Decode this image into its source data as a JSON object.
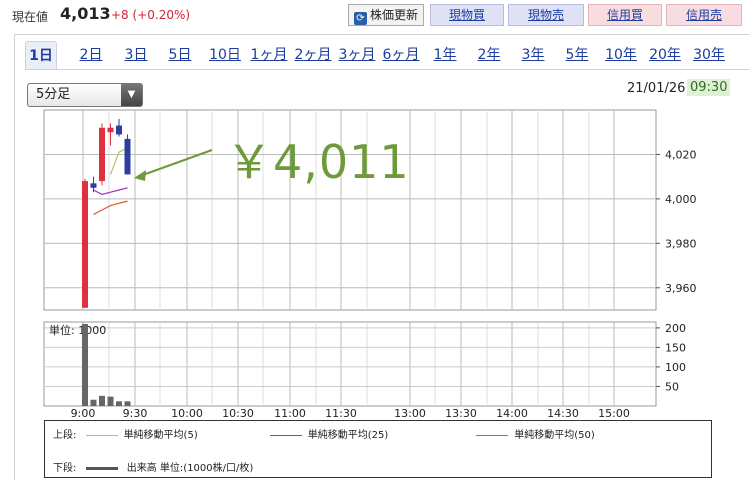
{
  "header": {
    "price_label": "現在値",
    "price_value": "4,013",
    "price_change": "+8 (+0.20%)",
    "refresh_label": "株価更新",
    "genbuy_label": "現物買",
    "gensell_label": "現物売",
    "crbuy_label": "信用買",
    "crsell_label": "信用売"
  },
  "tabs": [
    "1日",
    "2日",
    "3日",
    "5日",
    "10日",
    "1ヶ月",
    "2ヶ月",
    "3ヶ月",
    "6ヶ月",
    "1年",
    "2年",
    "3年",
    "5年",
    "10年",
    "20年",
    "30年"
  ],
  "active_tab": "1日",
  "interval_select": {
    "value": "5分足"
  },
  "timestamp": {
    "date": "21/01/26",
    "time": "09:30"
  },
  "annotation": "￥4,011",
  "chart_data": {
    "type": "candlestick",
    "price_axis": {
      "ticks": [
        "4,020",
        "4,000",
        "3,980",
        "3,960"
      ],
      "values": [
        4020,
        4000,
        3980,
        3960
      ],
      "range": [
        3950,
        4040
      ]
    },
    "volume_axis": {
      "unit_label": "単位: 1000",
      "ticks": [
        "200",
        "150",
        "100",
        "50"
      ],
      "values": [
        200,
        150,
        100,
        50
      ],
      "range": [
        0,
        215
      ]
    },
    "x_ticks": [
      "9:00",
      "9:30",
      "10:00",
      "10:30",
      "11:00",
      "11:30",
      "13:00",
      "13:30",
      "14:00",
      "14:30",
      "15:00"
    ],
    "candles": [
      {
        "time": "9:00",
        "open": 4008,
        "high": 4009,
        "low": 3951,
        "close": 3951,
        "color": "#e03040"
      },
      {
        "time": "9:05",
        "open": 4005,
        "high": 4010,
        "low": 4003,
        "close": 4007,
        "color": "#2d3f9e"
      },
      {
        "time": "9:10",
        "open": 4008,
        "high": 4034,
        "low": 4006,
        "close": 4032,
        "color": "#e03040"
      },
      {
        "time": "9:15",
        "open": 4030,
        "high": 4034,
        "low": 4024,
        "close": 4032,
        "color": "#e03040"
      },
      {
        "time": "9:20",
        "open": 4033,
        "high": 4036,
        "low": 4028,
        "close": 4029,
        "color": "#2d3f9e"
      },
      {
        "time": "9:25",
        "open": 4027,
        "high": 4029,
        "low": 4011,
        "close": 4011,
        "color": "#2d3f9e"
      }
    ],
    "volume": [
      {
        "time": "9:00",
        "value": 210
      },
      {
        "time": "9:05",
        "value": 16
      },
      {
        "time": "9:10",
        "value": 26
      },
      {
        "time": "9:15",
        "value": 24
      },
      {
        "time": "9:20",
        "value": 12
      },
      {
        "time": "9:25",
        "value": 12
      }
    ],
    "series": [
      {
        "name": "単純移動平均(5)",
        "color": "#b3c55a",
        "points": [
          [
            3,
            4011
          ],
          [
            4,
            4021
          ],
          [
            5,
            4023
          ]
        ]
      },
      {
        "name": "単純移動平均(25)",
        "color": "#9b32c6",
        "points": [
          [
            1,
            4004
          ],
          [
            2,
            4002
          ],
          [
            3,
            4003
          ],
          [
            4,
            4004
          ],
          [
            5,
            4005
          ]
        ]
      },
      {
        "name": "単純移動平均(50)",
        "color": "#e05a2a",
        "points": [
          [
            1,
            3993
          ],
          [
            2,
            3995
          ],
          [
            3,
            3997
          ],
          [
            4,
            3998
          ],
          [
            5,
            3999
          ]
        ]
      }
    ]
  },
  "legend": {
    "upper_label": "上段:",
    "lower_label": "下段:",
    "upper_items": [
      {
        "label": "単純移動平均(5)",
        "color": "#b3c55a"
      },
      {
        "label": "単純移動平均(25)",
        "color": "#9b32c6"
      },
      {
        "label": "単純移動平均(50)",
        "color": "#e05a2a"
      }
    ],
    "lower_item": {
      "label": "出来高 単位:(1000株/口/枚)",
      "color": "#555555"
    }
  }
}
